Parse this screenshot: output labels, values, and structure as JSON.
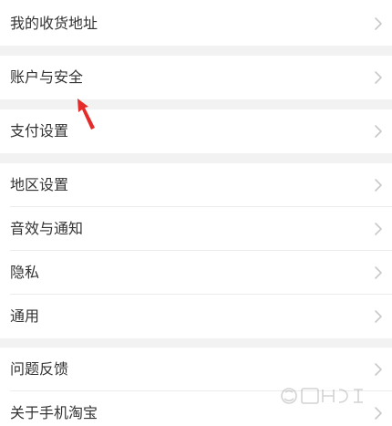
{
  "settings": {
    "groups": [
      {
        "items": [
          {
            "label": "我的收货地址"
          }
        ]
      },
      {
        "items": [
          {
            "label": "账户与安全"
          }
        ]
      },
      {
        "items": [
          {
            "label": "支付设置"
          }
        ]
      },
      {
        "items": [
          {
            "label": "地区设置"
          },
          {
            "label": "音效与通知"
          },
          {
            "label": "隐私"
          },
          {
            "label": "通用"
          }
        ]
      },
      {
        "items": [
          {
            "label": "问题反馈"
          },
          {
            "label": "关于手机淘宝"
          }
        ]
      }
    ]
  },
  "annotation": {
    "pointer_icon": "red-arrow-icon",
    "pointer_color": "#e52a2a"
  },
  "watermark": {
    "icon": "baidu-jingyan-watermark-icon"
  },
  "colors": {
    "background": "#f2f2f2",
    "row_background": "#ffffff",
    "text": "#333333",
    "chevron": "#c8c8c8",
    "divider": "#ececec"
  }
}
